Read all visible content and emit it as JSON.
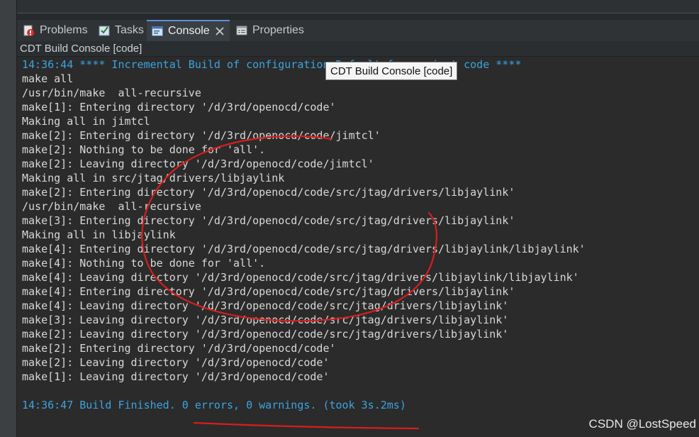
{
  "tabs": [
    {
      "label": "Problems",
      "icon": "problems-icon"
    },
    {
      "label": "Tasks",
      "icon": "tasks-icon"
    },
    {
      "label": "Console",
      "icon": "console-icon",
      "active": true
    },
    {
      "label": "Properties",
      "icon": "properties-icon"
    }
  ],
  "console_title": "CDT Build Console [code]",
  "tooltip_text": "CDT Build Console [code]",
  "console_lines": [
    {
      "text": "14:36:44 **** Incremental Build of configuration Default for project code ****",
      "type": "info"
    },
    {
      "text": "make all",
      "type": "normal"
    },
    {
      "text": "/usr/bin/make  all-recursive",
      "type": "normal"
    },
    {
      "text": "make[1]: Entering directory '/d/3rd/openocd/code'",
      "type": "normal"
    },
    {
      "text": "Making all in jimtcl",
      "type": "normal"
    },
    {
      "text": "make[2]: Entering directory '/d/3rd/openocd/code/jimtcl'",
      "type": "normal"
    },
    {
      "text": "make[2]: Nothing to be done for 'all'.",
      "type": "normal"
    },
    {
      "text": "make[2]: Leaving directory '/d/3rd/openocd/code/jimtcl'",
      "type": "normal"
    },
    {
      "text": "Making all in src/jtag/drivers/libjaylink",
      "type": "normal"
    },
    {
      "text": "make[2]: Entering directory '/d/3rd/openocd/code/src/jtag/drivers/libjaylink'",
      "type": "normal"
    },
    {
      "text": "/usr/bin/make  all-recursive",
      "type": "normal"
    },
    {
      "text": "make[3]: Entering directory '/d/3rd/openocd/code/src/jtag/drivers/libjaylink'",
      "type": "normal"
    },
    {
      "text": "Making all in libjaylink",
      "type": "normal"
    },
    {
      "text": "make[4]: Entering directory '/d/3rd/openocd/code/src/jtag/drivers/libjaylink/libjaylink'",
      "type": "normal"
    },
    {
      "text": "make[4]: Nothing to be done for 'all'.",
      "type": "normal"
    },
    {
      "text": "make[4]: Leaving directory '/d/3rd/openocd/code/src/jtag/drivers/libjaylink/libjaylink'",
      "type": "normal"
    },
    {
      "text": "make[4]: Entering directory '/d/3rd/openocd/code/src/jtag/drivers/libjaylink'",
      "type": "normal"
    },
    {
      "text": "make[4]: Leaving directory '/d/3rd/openocd/code/src/jtag/drivers/libjaylink'",
      "type": "normal"
    },
    {
      "text": "make[3]: Leaving directory '/d/3rd/openocd/code/src/jtag/drivers/libjaylink'",
      "type": "normal"
    },
    {
      "text": "make[2]: Leaving directory '/d/3rd/openocd/code/src/jtag/drivers/libjaylink'",
      "type": "normal"
    },
    {
      "text": "make[2]: Entering directory '/d/3rd/openocd/code'",
      "type": "normal"
    },
    {
      "text": "make[2]: Leaving directory '/d/3rd/openocd/code'",
      "type": "normal"
    },
    {
      "text": "make[1]: Leaving directory '/d/3rd/openocd/code'",
      "type": "normal"
    },
    {
      "text": "",
      "type": "normal"
    },
    {
      "text": "14:36:47 Build Finished. 0 errors, 0 warnings. (took 3s.2ms)",
      "type": "info"
    }
  ],
  "watermark": "CSDN @LostSpeed",
  "colors": {
    "info_text": "#3aa4e0",
    "normal_text": "#d8d8d8",
    "console_bg": "#2b2b2b",
    "annotation_red": "#d81e1e"
  }
}
